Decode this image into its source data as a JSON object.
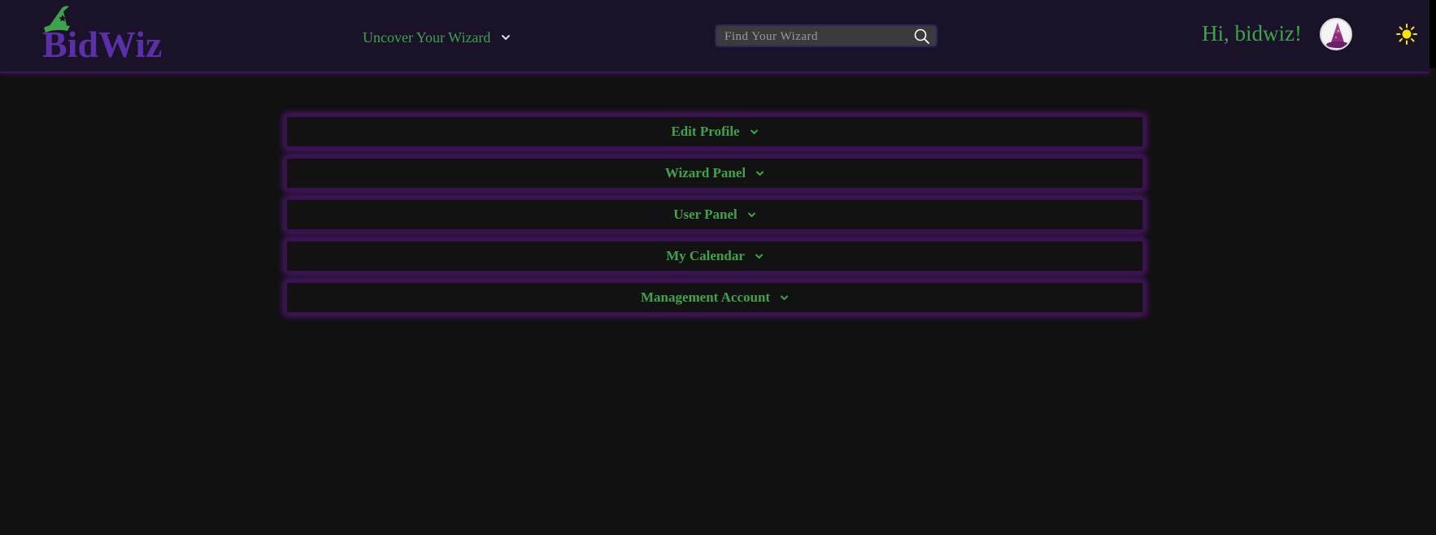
{
  "brand": {
    "name": "BidWiz",
    "logo_icon": "wizard-hat-icon",
    "text_color": "#5b2fa8",
    "hat_color": "#3ea34a"
  },
  "nav": {
    "uncover_label": "Uncover Your Wizard"
  },
  "search": {
    "placeholder": "Find Your Wizard",
    "value": ""
  },
  "user": {
    "greeting": "Hi, bidwiz!"
  },
  "panels": [
    {
      "label": "Edit Profile"
    },
    {
      "label": "Wizard Panel"
    },
    {
      "label": "User Panel"
    },
    {
      "label": "My Calendar"
    },
    {
      "label": "Management Account"
    }
  ],
  "colors": {
    "accent_green": "#3ea34a",
    "brand_purple": "#5b2fa8",
    "panel_glow": "#5f1987",
    "header_bg": "#1a1228",
    "page_bg": "#111111",
    "sun": "#f5e400"
  }
}
